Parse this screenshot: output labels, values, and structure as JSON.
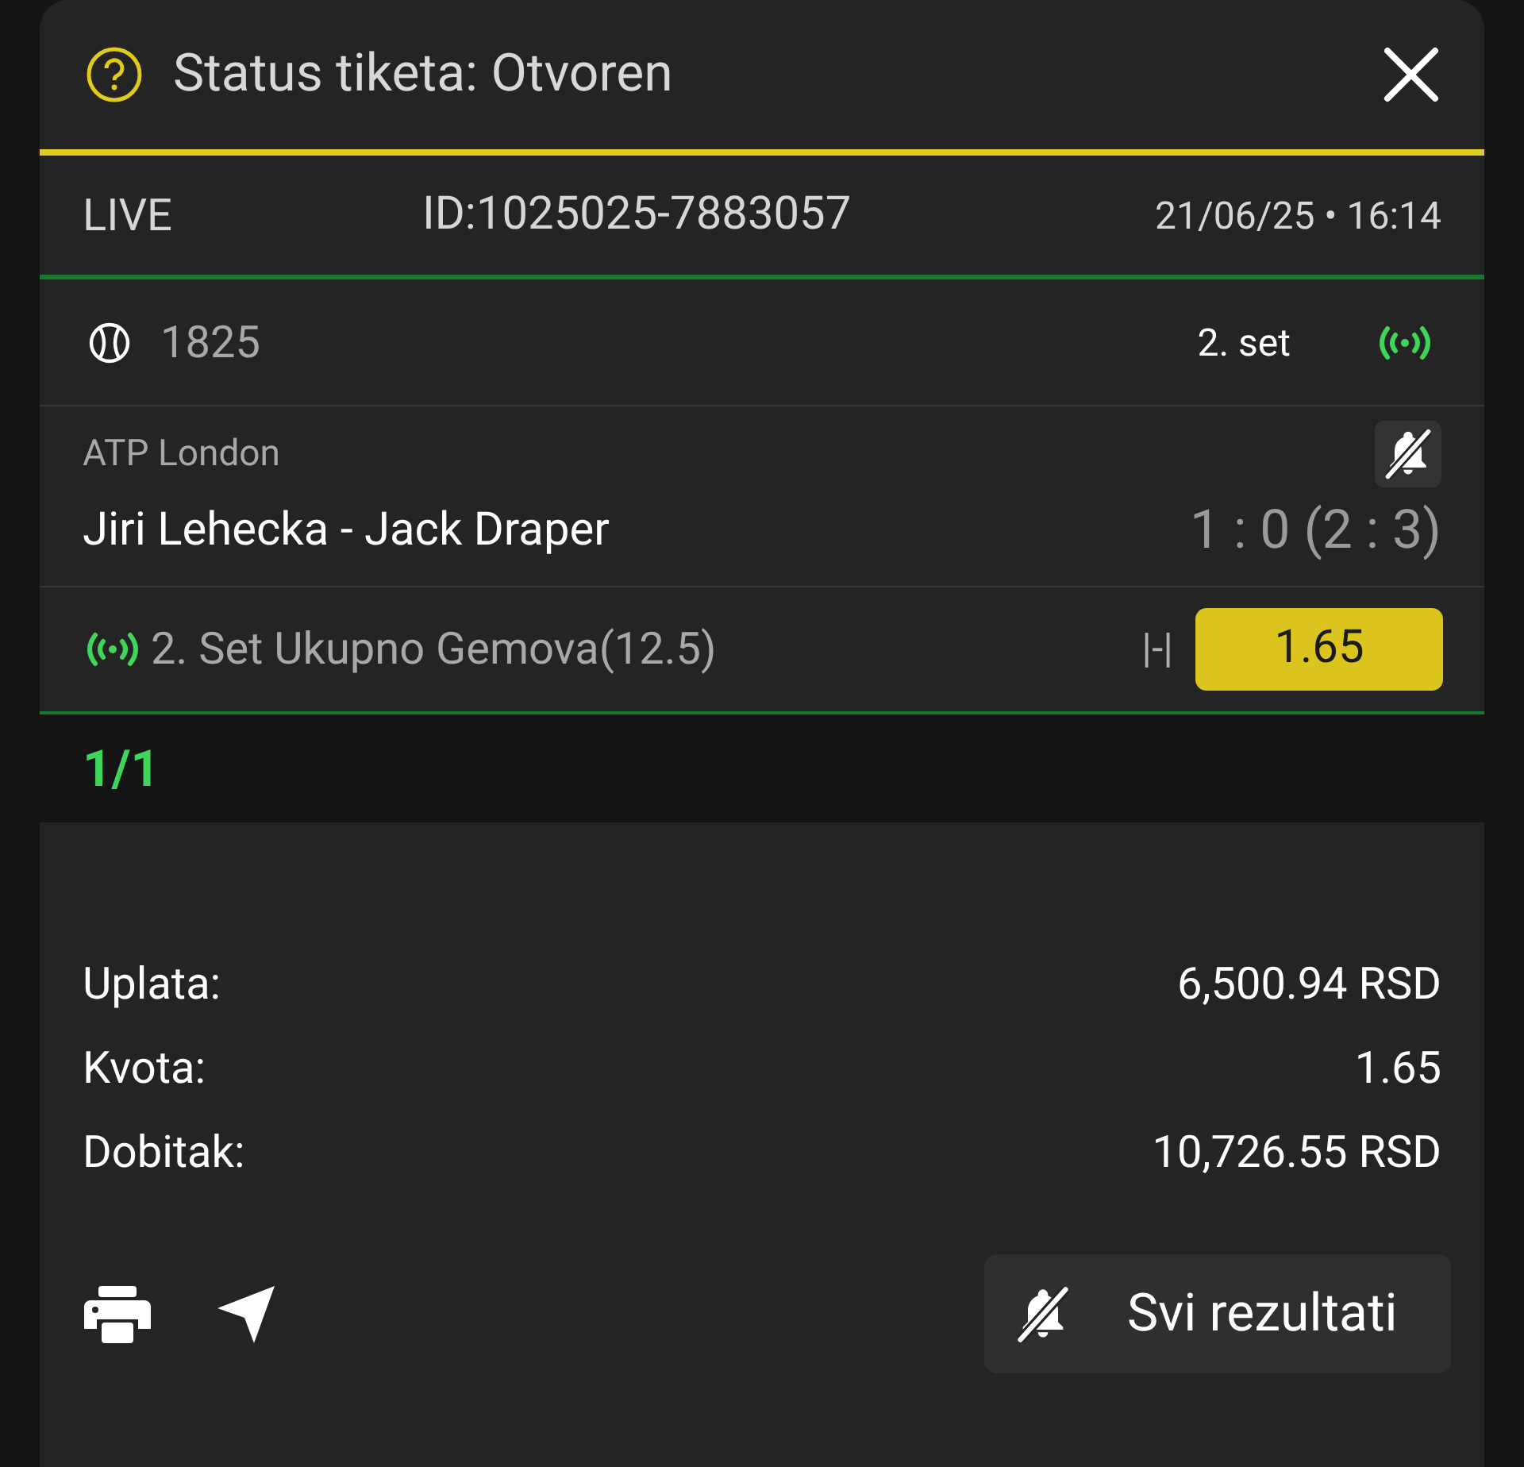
{
  "header": {
    "title": "Status tiketa: Otvoren"
  },
  "ticket": {
    "type": "LIVE",
    "id": "ID:1025025-7883057",
    "datetime": "21/06/25 • 16:14"
  },
  "match": {
    "code": "1825",
    "period": "2. set",
    "league": "ATP London",
    "teams": "Jiri Lehecka - Jack Draper",
    "score": "1 : 0 (2 : 3)",
    "market": "2. Set Ukupno Gemova(12.5)",
    "pick": "|-|",
    "odds": "1.65"
  },
  "count": "1/1",
  "totals": [
    {
      "label": "Uplata:",
      "value": "6,500.94 RSD"
    },
    {
      "label": "Kvota:",
      "value": "1.65"
    },
    {
      "label": "Dobitak:",
      "value": "10,726.55 RSD"
    }
  ],
  "results_button": "Svi rezultati"
}
